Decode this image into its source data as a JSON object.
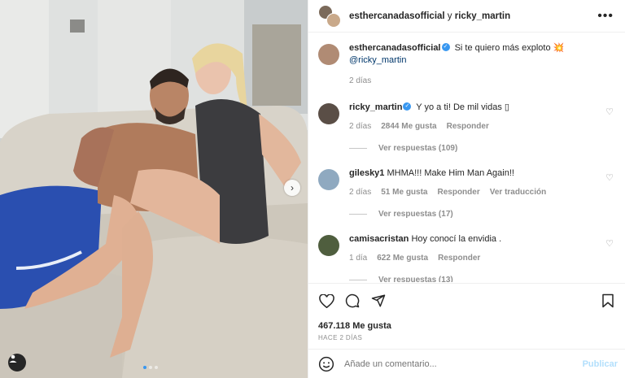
{
  "header": {
    "account_1": "esthercanadasofficial",
    "joiner": " y ",
    "account_2": "ricky_martin",
    "more_icon": "more-horizontal-icon"
  },
  "caption": {
    "user": "esthercanadasofficial",
    "text": "Si te quiero más exploto 💥",
    "mention": "@ricky_martin",
    "time": "2 días"
  },
  "comments": [
    {
      "user": "ricky_martin",
      "verified": true,
      "text": "Y yo a ti! De mil vidas ▯",
      "time": "2 días",
      "likes": "2844 Me gusta",
      "reply": "Responder",
      "translate": "",
      "replies": "Ver respuestas (109)",
      "avatar_color": "#5a4e46"
    },
    {
      "user": "gilesky1",
      "verified": false,
      "text": "MHMA!!! Make Him Man Again!!",
      "time": "2 días",
      "likes": "51 Me gusta",
      "reply": "Responder",
      "translate": "Ver traducción",
      "replies": "Ver respuestas (17)",
      "avatar_color": "#8fa9c0"
    },
    {
      "user": "camisacristan",
      "verified": false,
      "text": "Hoy conocí la envidia .",
      "time": "1 día",
      "likes": "622 Me gusta",
      "reply": "Responder",
      "translate": "",
      "replies": "Ver respuestas (13)",
      "avatar_color": "#4f5e3e"
    }
  ],
  "post": {
    "likes": "467.118 Me gusta",
    "ago": "HACE 2 DÍAS"
  },
  "add_comment": {
    "placeholder": "Añade un comentario...",
    "post_label": "Publicar"
  },
  "colors": {
    "link": "#00376b",
    "verified": "#3897f0",
    "secondary_text": "#8e8e8e",
    "publish_disabled": "#b2dffc"
  }
}
